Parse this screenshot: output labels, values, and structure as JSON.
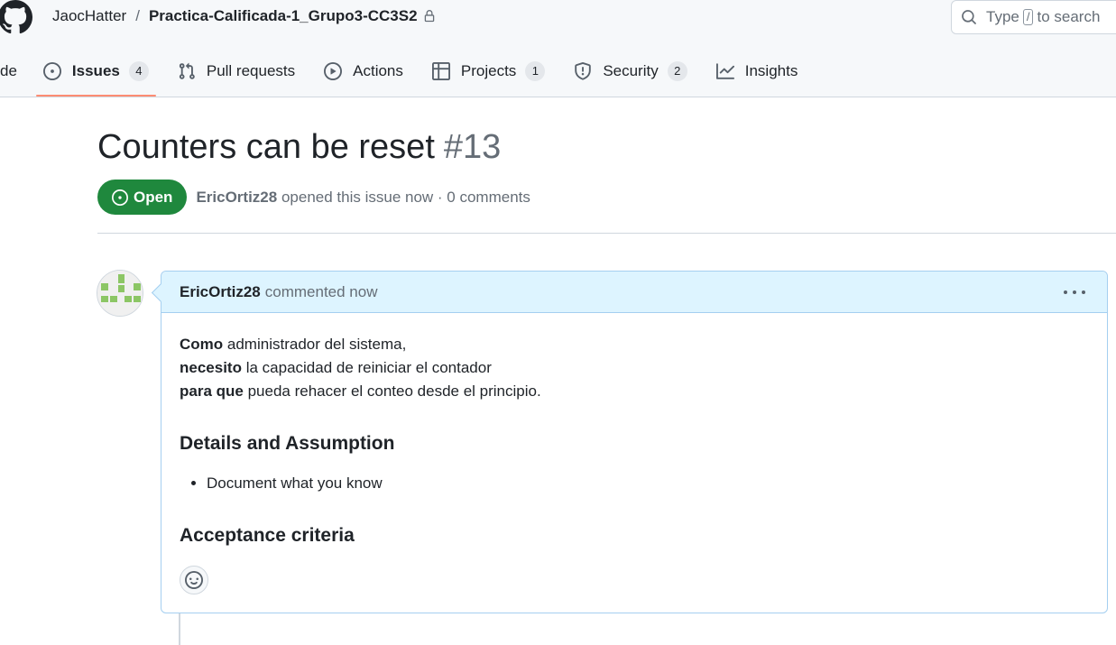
{
  "header": {
    "owner": "JaocHatter",
    "separator": "/",
    "repo": "Practica-Calificada-1_Grupo3-CC3S2",
    "search": {
      "before": "Type",
      "key": "/",
      "after": "to search"
    }
  },
  "tabs": [
    {
      "label": "de"
    },
    {
      "label": "Issues",
      "count": "4"
    },
    {
      "label": "Pull requests"
    },
    {
      "label": "Actions"
    },
    {
      "label": "Projects",
      "count": "1"
    },
    {
      "label": "Security",
      "count": "2"
    },
    {
      "label": "Insights"
    }
  ],
  "issue": {
    "title": "Counters can be reset",
    "number": "#13",
    "state": "Open",
    "author": "EricOrtiz28",
    "meta": "opened this issue now · 0 comments"
  },
  "comment": {
    "author": "EricOrtiz28",
    "action": "commented now",
    "lines": [
      {
        "bold": "Como",
        "text": " administrador del sistema,"
      },
      {
        "bold": "necesito",
        "text": " la capacidad de reiniciar el contador"
      },
      {
        "bold": "para que",
        "text": " pueda rehacer el conteo desde el principio."
      }
    ],
    "heading1": "Details and Assumption",
    "bullet1": "Document what you know",
    "heading2": "Acceptance criteria"
  },
  "colors": {
    "open_green": "#1f883d",
    "tab_underline": "#fd8c73",
    "comment_header_bg": "#ddf4ff",
    "avatar_green": "#8cc665"
  }
}
